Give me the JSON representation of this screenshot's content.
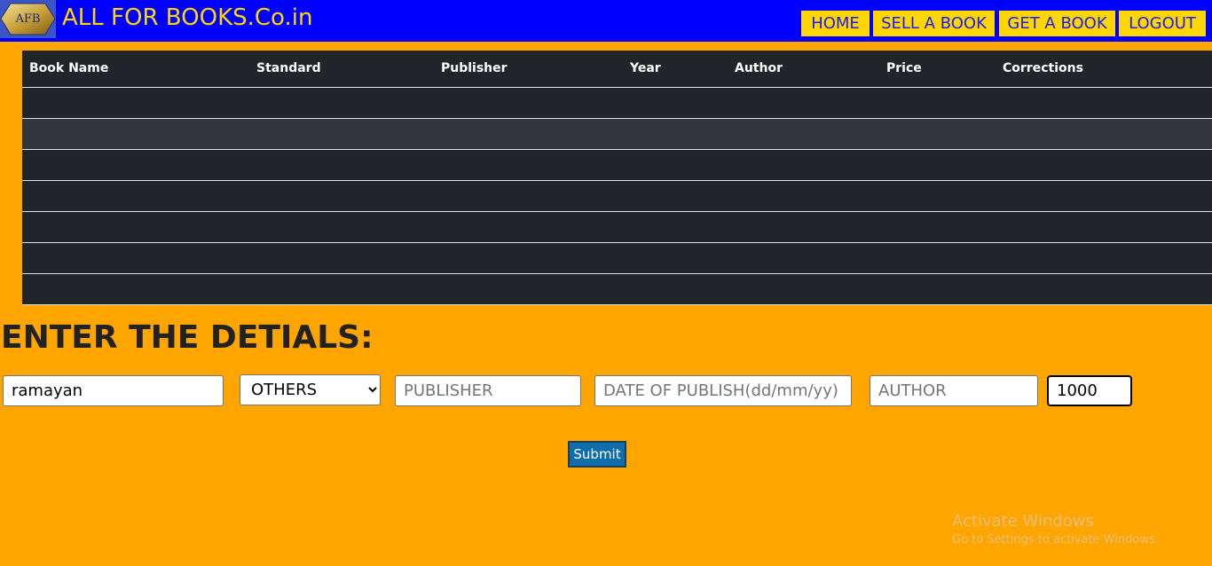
{
  "header": {
    "logo_text": "AFB",
    "title": "ALL FOR BOOKS.Co.in",
    "nav": [
      {
        "label": "HOME"
      },
      {
        "label": "SELL A BOOK"
      },
      {
        "label": "GET A BOOK"
      },
      {
        "label": "LOGOUT"
      }
    ]
  },
  "table": {
    "columns": [
      "Book Name",
      "Standard",
      "Publisher",
      "Year",
      "Author",
      "Price",
      "Corrections"
    ],
    "row_count": 7
  },
  "form": {
    "heading": "ENTER THE DETIALS:",
    "book_name": {
      "value": "ramayan",
      "placeholder": ""
    },
    "standard": {
      "selected": "OTHERS"
    },
    "publisher": {
      "value": "",
      "placeholder": "PUBLISHER"
    },
    "date_of_publish": {
      "value": "",
      "placeholder": "DATE OF PUBLISH(dd/mm/yy)"
    },
    "author": {
      "value": "",
      "placeholder": "AUTHOR"
    },
    "price": {
      "value": "1000",
      "placeholder": ""
    },
    "submit_label": "Submit"
  },
  "watermark": {
    "title": "Activate Windows",
    "subtitle": "Go to Settings to activate Windows."
  },
  "colors": {
    "page_bg": "#ffa500",
    "header_bg": "#0000ff",
    "accent_yellow": "#ffd700",
    "table_bg": "#212529",
    "submit_bg": "#0d6eab"
  }
}
